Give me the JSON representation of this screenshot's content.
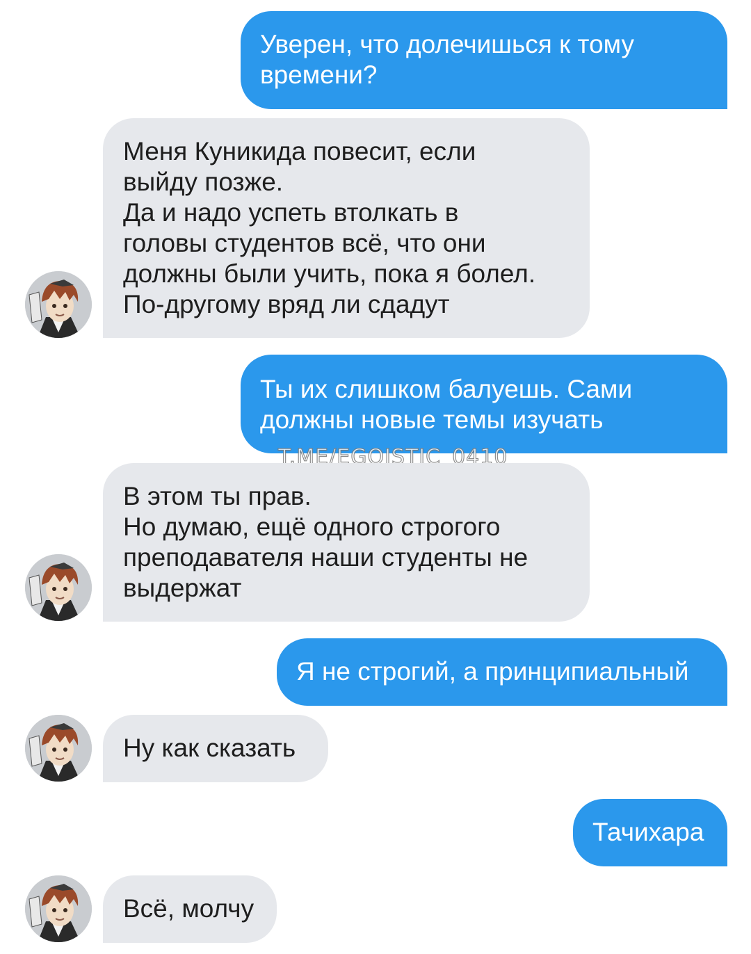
{
  "chat": {
    "messages": [
      {
        "direction": "outgoing",
        "text": "Уверен, что долечишься к тому\nвремени?"
      },
      {
        "direction": "incoming",
        "text": "Меня Куникида повесит, если\nвыйду позже.\nДа и надо успеть втолкать в\nголовы студентов всё, что они\nдолжны были учить, пока я болел.\nПо-другому вряд ли сдадут"
      },
      {
        "direction": "outgoing",
        "text": "Ты их слишком балуешь. Сами\nдолжны новые темы изучать"
      },
      {
        "direction": "incoming",
        "text": "В этом ты прав.\nНо думаю, ещё одного строгого\nпреподавателя наши студенты не\nвыдержат"
      },
      {
        "direction": "outgoing",
        "text": "Я не строгий, а принципиальный"
      },
      {
        "direction": "incoming",
        "text": "Ну как сказать"
      },
      {
        "direction": "outgoing",
        "text": "Тачихара"
      },
      {
        "direction": "incoming",
        "text": "Всё, молчу"
      }
    ]
  },
  "watermark": {
    "text": "T.ME/EGOISTIC_0410"
  },
  "colors": {
    "outgoing_bubble": "#2b98ec",
    "incoming_bubble": "#e6e8ec",
    "background": "#ffffff"
  },
  "icons": {
    "avatar": "avatar-image"
  }
}
